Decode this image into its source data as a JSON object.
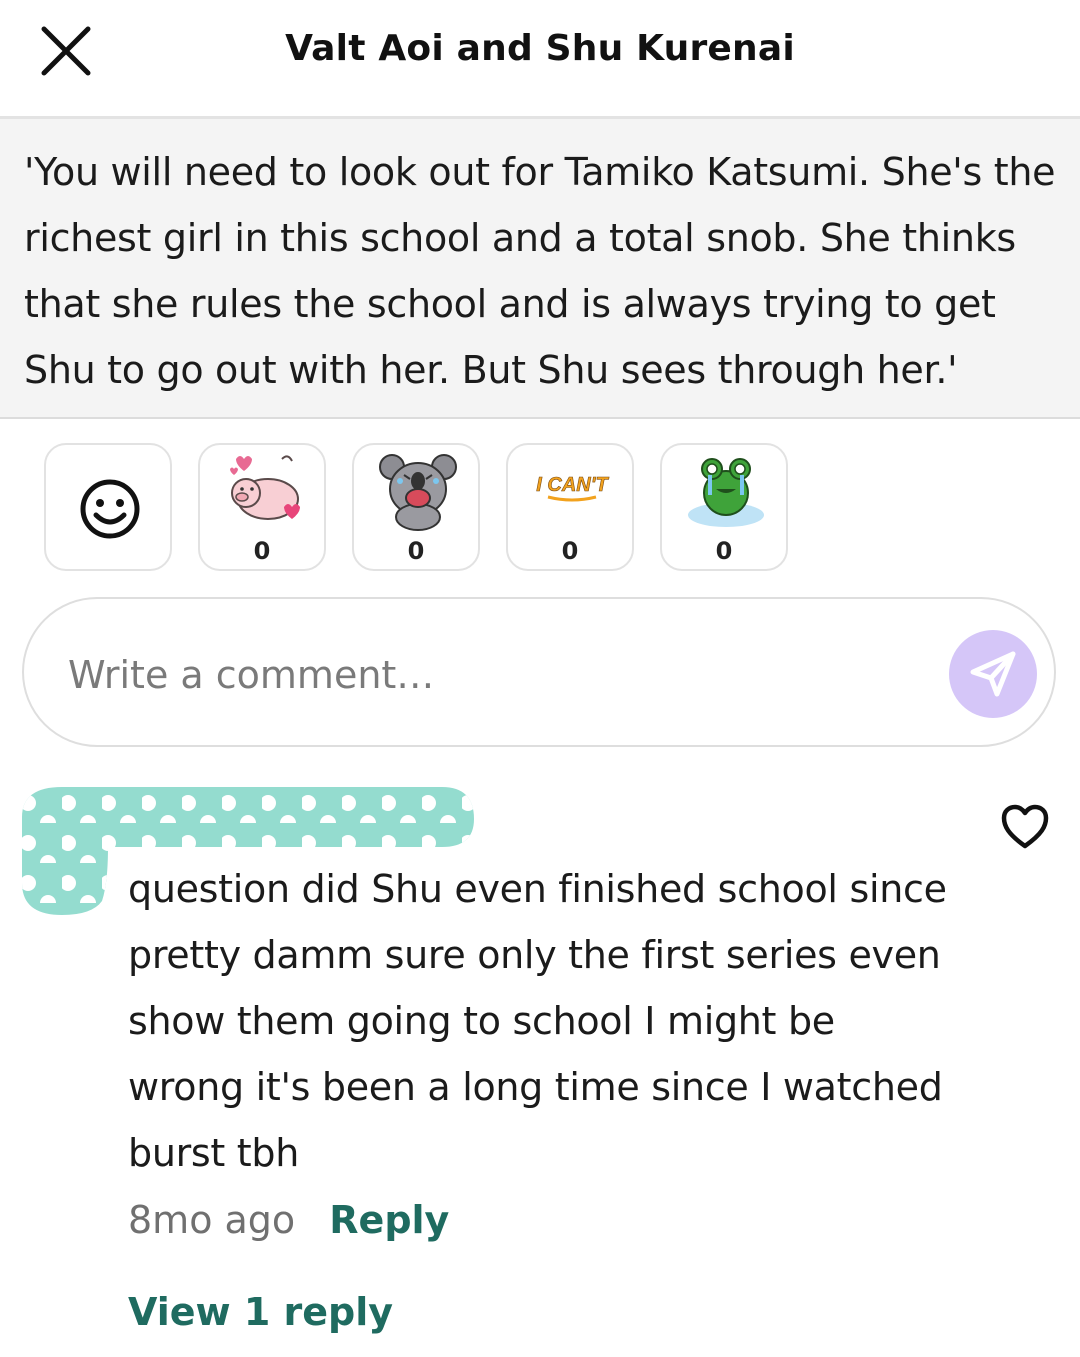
{
  "header": {
    "title": "Valt Aoi and Shu Kurenai",
    "close_icon": "close-icon"
  },
  "quote": {
    "text": "'You will need to look out for Tamiko Katsumi. She's the richest girl in this school and a total snob. She thinks that she rules the school and is always trying to get Shu to go out with her. But Shu sees through her.'"
  },
  "reactions": [
    {
      "icon": "smiley-icon"
    },
    {
      "icon": "pig-hearts-sticker",
      "count": "0"
    },
    {
      "icon": "koala-laughing-sticker",
      "count": "0"
    },
    {
      "icon": "i-cant-sticker",
      "count": "0",
      "sticker_text": "I CAN'T"
    },
    {
      "icon": "crying-frog-sticker",
      "count": "0"
    }
  ],
  "comment_input": {
    "placeholder": "Write a comment…",
    "send_icon": "send-icon",
    "send_color": "#d5c6f8"
  },
  "comment": {
    "text": "question did Shu even finished school since pretty damm sure only the first series even show them going to school I might be wrong it's been a long time since I watched burst tbh",
    "time": "8mo ago",
    "reply_label": "Reply",
    "view_replies_label": "View 1 reply",
    "like_icon": "heart-outline-icon",
    "accent_color": "#1f6b60",
    "redaction_color": "#94dccf"
  }
}
